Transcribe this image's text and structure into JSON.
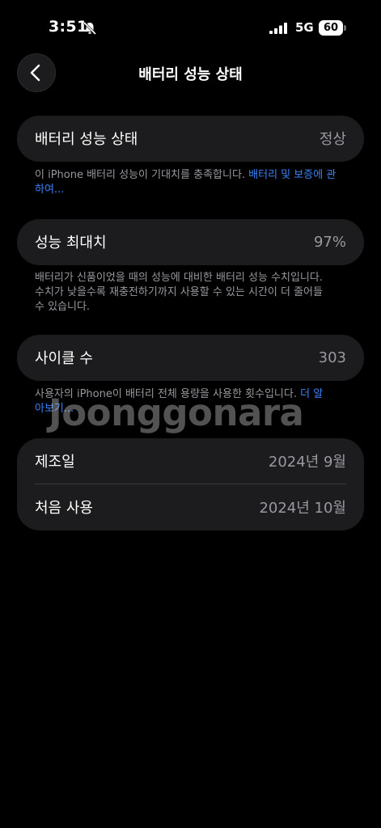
{
  "status_bar": {
    "time": "3:51",
    "network": "5G",
    "battery": "60"
  },
  "nav": {
    "title": "배터리 성능 상태"
  },
  "sections": {
    "health": {
      "label": "배터리 성능 상태",
      "value": "정상",
      "footnote_text": "이 iPhone 배터리 성능이 기대치를 충족합니다. ",
      "footnote_link": "배터리 및 보증에 관하여..."
    },
    "max_capacity": {
      "label": "성능 최대치",
      "value": "97%",
      "footnote_text": "배터리가 신품이었을 때의 성능에 대비한 배터리 성능 수치입니다. 수치가 낮을수록 재충전하기까지 사용할 수 있는 시간이 더 줄어들 수 있습니다."
    },
    "cycle_count": {
      "label": "사이클 수",
      "value": "303",
      "footnote_text": "사용자의 iPhone이 배터리 전체 용량을 사용한 횟수입니다. ",
      "footnote_link": "더 알아보기..."
    },
    "dates": {
      "manufacture_label": "제조일",
      "manufacture_value": "2024년 9월",
      "first_use_label": "처음 사용",
      "first_use_value": "2024년 10월"
    }
  },
  "watermark": "Joonggonara",
  "colors": {
    "background": "#000000",
    "card": "#1c1c1e",
    "secondary_text": "#98989f",
    "link": "#3b82f6"
  }
}
